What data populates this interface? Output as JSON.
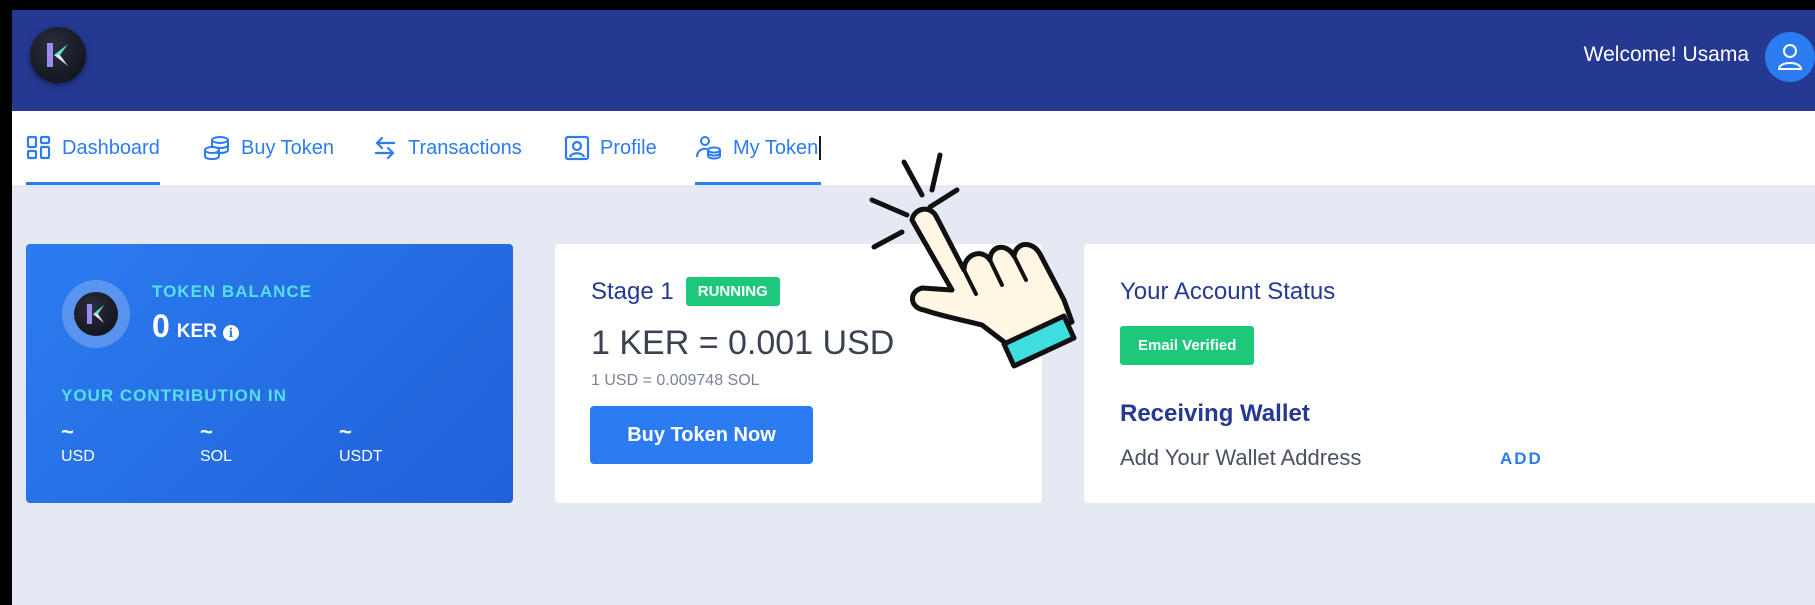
{
  "header": {
    "logo_icon": "ker-logo-icon",
    "welcome_text": "Welcome! Usama",
    "user_icon": "user-icon"
  },
  "nav": {
    "items": [
      {
        "label": "Dashboard",
        "icon": "dashboard-grid-icon",
        "active": true
      },
      {
        "label": "Buy Token",
        "icon": "coins-stack-icon",
        "active": false
      },
      {
        "label": "Transactions",
        "icon": "swap-arrows-icon",
        "active": false
      },
      {
        "label": "Profile",
        "icon": "profile-card-icon",
        "active": false
      },
      {
        "label": "My Token",
        "icon": "user-coins-icon",
        "active": true
      }
    ]
  },
  "balance_card": {
    "title": "TOKEN BALANCE",
    "value": "0",
    "unit": "KER",
    "info_icon": "info-icon",
    "contribution_title": "YOUR CONTRIBUTION IN",
    "contributions": [
      {
        "value": "~",
        "currency": "USD"
      },
      {
        "value": "~",
        "currency": "SOL"
      },
      {
        "value": "~",
        "currency": "USDT"
      }
    ]
  },
  "stage_card": {
    "title": "Stage 1",
    "status": "RUNNING",
    "rate": "1 KER = 0.001 USD",
    "sub_rate": "1 USD = 0.009748 SOL",
    "button_label": "Buy Token Now"
  },
  "status_card": {
    "title": "Your Account Status",
    "email_badge": "Email Verified",
    "wallet_title": "Receiving Wallet",
    "wallet_placeholder": "Add Your Wallet Address",
    "add_label": "ADD"
  },
  "overlay": {
    "cursor_icon": "pointing-hand-cursor-icon"
  },
  "colors": {
    "topbar": "#253993",
    "accent": "#2b7cf0",
    "success": "#1ec87a",
    "cyan_label": "#58e0ea",
    "background": "#e4e9f3"
  }
}
